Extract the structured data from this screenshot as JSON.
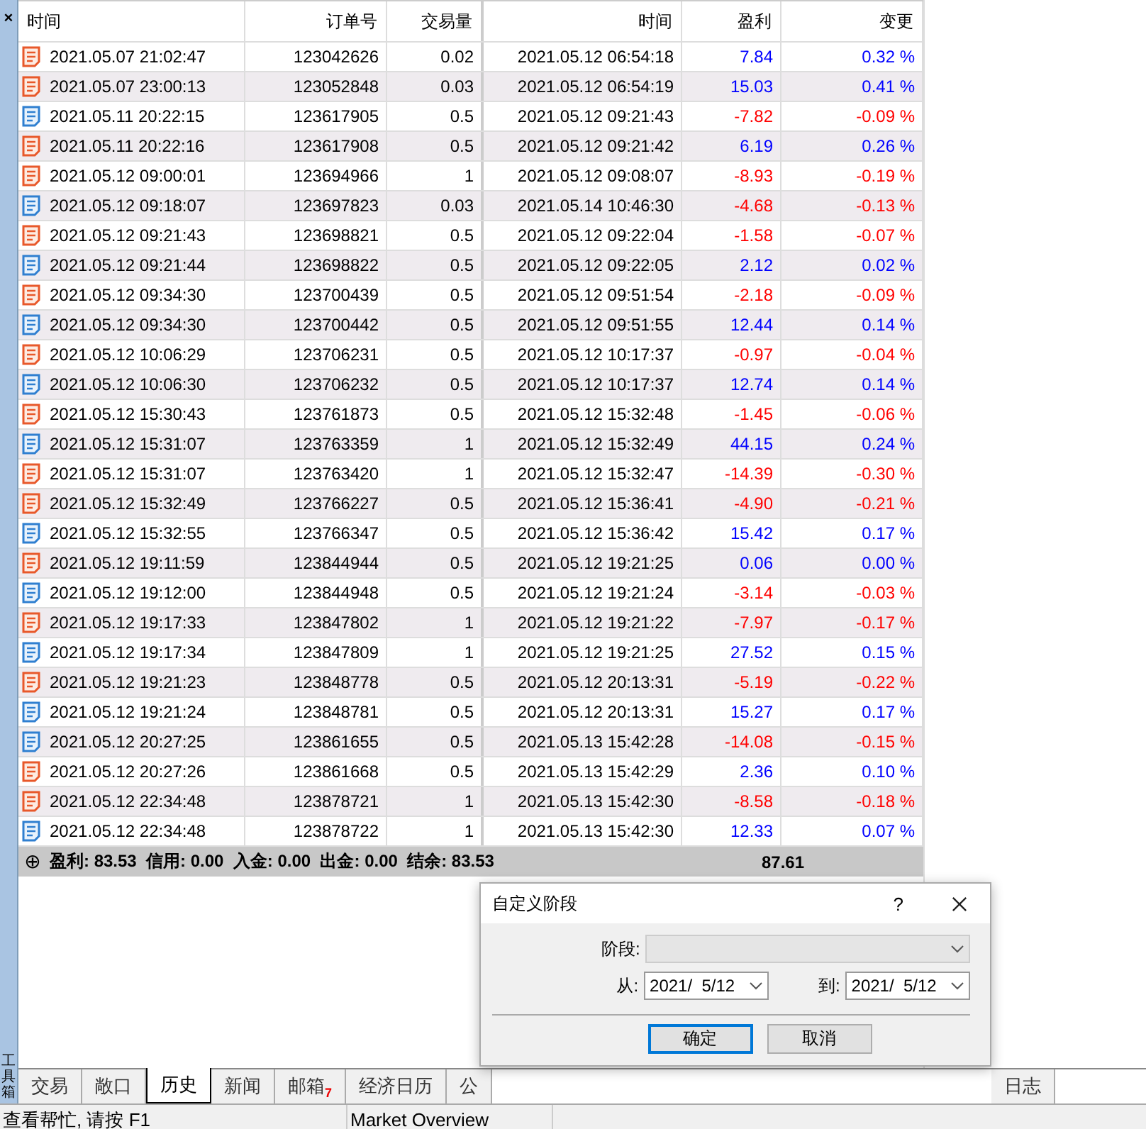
{
  "toolbox": {
    "close": "×",
    "title": "工具箱"
  },
  "table": {
    "columns": [
      "时间",
      "订单号",
      "交易量",
      "时间",
      "盈利",
      "变更"
    ],
    "rows": [
      {
        "kind": "sell",
        "open_time": "2021.05.07 21:02:47",
        "order": "123042626",
        "volume": "0.02",
        "close_time": "2021.05.12 06:54:18",
        "profit": "7.84",
        "change": "0.32 %",
        "loss": false
      },
      {
        "kind": "sell",
        "open_time": "2021.05.07 23:00:13",
        "order": "123052848",
        "volume": "0.03",
        "close_time": "2021.05.12 06:54:19",
        "profit": "15.03",
        "change": "0.41 %",
        "loss": false
      },
      {
        "kind": "buy",
        "open_time": "2021.05.11 20:22:15",
        "order": "123617905",
        "volume": "0.5",
        "close_time": "2021.05.12 09:21:43",
        "profit": "-7.82",
        "change": "-0.09 %",
        "loss": true
      },
      {
        "kind": "sell",
        "open_time": "2021.05.11 20:22:16",
        "order": "123617908",
        "volume": "0.5",
        "close_time": "2021.05.12 09:21:42",
        "profit": "6.19",
        "change": "0.26 %",
        "loss": false
      },
      {
        "kind": "sell",
        "open_time": "2021.05.12 09:00:01",
        "order": "123694966",
        "volume": "1",
        "close_time": "2021.05.12 09:08:07",
        "profit": "-8.93",
        "change": "-0.19 %",
        "loss": true
      },
      {
        "kind": "buy",
        "open_time": "2021.05.12 09:18:07",
        "order": "123697823",
        "volume": "0.03",
        "close_time": "2021.05.14 10:46:30",
        "profit": "-4.68",
        "change": "-0.13 %",
        "loss": true
      },
      {
        "kind": "sell",
        "open_time": "2021.05.12 09:21:43",
        "order": "123698821",
        "volume": "0.5",
        "close_time": "2021.05.12 09:22:04",
        "profit": "-1.58",
        "change": "-0.07 %",
        "loss": true
      },
      {
        "kind": "buy",
        "open_time": "2021.05.12 09:21:44",
        "order": "123698822",
        "volume": "0.5",
        "close_time": "2021.05.12 09:22:05",
        "profit": "2.12",
        "change": "0.02 %",
        "loss": false
      },
      {
        "kind": "sell",
        "open_time": "2021.05.12 09:34:30",
        "order": "123700439",
        "volume": "0.5",
        "close_time": "2021.05.12 09:51:54",
        "profit": "-2.18",
        "change": "-0.09 %",
        "loss": true
      },
      {
        "kind": "buy",
        "open_time": "2021.05.12 09:34:30",
        "order": "123700442",
        "volume": "0.5",
        "close_time": "2021.05.12 09:51:55",
        "profit": "12.44",
        "change": "0.14 %",
        "loss": false
      },
      {
        "kind": "sell",
        "open_time": "2021.05.12 10:06:29",
        "order": "123706231",
        "volume": "0.5",
        "close_time": "2021.05.12 10:17:37",
        "profit": "-0.97",
        "change": "-0.04 %",
        "loss": true
      },
      {
        "kind": "buy",
        "open_time": "2021.05.12 10:06:30",
        "order": "123706232",
        "volume": "0.5",
        "close_time": "2021.05.12 10:17:37",
        "profit": "12.74",
        "change": "0.14 %",
        "loss": false
      },
      {
        "kind": "sell",
        "open_time": "2021.05.12 15:30:43",
        "order": "123761873",
        "volume": "0.5",
        "close_time": "2021.05.12 15:32:48",
        "profit": "-1.45",
        "change": "-0.06 %",
        "loss": true
      },
      {
        "kind": "buy",
        "open_time": "2021.05.12 15:31:07",
        "order": "123763359",
        "volume": "1",
        "close_time": "2021.05.12 15:32:49",
        "profit": "44.15",
        "change": "0.24 %",
        "loss": false
      },
      {
        "kind": "sell",
        "open_time": "2021.05.12 15:31:07",
        "order": "123763420",
        "volume": "1",
        "close_time": "2021.05.12 15:32:47",
        "profit": "-14.39",
        "change": "-0.30 %",
        "loss": true
      },
      {
        "kind": "sell",
        "open_time": "2021.05.12 15:32:49",
        "order": "123766227",
        "volume": "0.5",
        "close_time": "2021.05.12 15:36:41",
        "profit": "-4.90",
        "change": "-0.21 %",
        "loss": true
      },
      {
        "kind": "buy",
        "open_time": "2021.05.12 15:32:55",
        "order": "123766347",
        "volume": "0.5",
        "close_time": "2021.05.12 15:36:42",
        "profit": "15.42",
        "change": "0.17 %",
        "loss": false
      },
      {
        "kind": "sell",
        "open_time": "2021.05.12 19:11:59",
        "order": "123844944",
        "volume": "0.5",
        "close_time": "2021.05.12 19:21:25",
        "profit": "0.06",
        "change": "0.00 %",
        "loss": false
      },
      {
        "kind": "buy",
        "open_time": "2021.05.12 19:12:00",
        "order": "123844948",
        "volume": "0.5",
        "close_time": "2021.05.12 19:21:24",
        "profit": "-3.14",
        "change": "-0.03 %",
        "loss": true
      },
      {
        "kind": "sell",
        "open_time": "2021.05.12 19:17:33",
        "order": "123847802",
        "volume": "1",
        "close_time": "2021.05.12 19:21:22",
        "profit": "-7.97",
        "change": "-0.17 %",
        "loss": true
      },
      {
        "kind": "buy",
        "open_time": "2021.05.12 19:17:34",
        "order": "123847809",
        "volume": "1",
        "close_time": "2021.05.12 19:21:25",
        "profit": "27.52",
        "change": "0.15 %",
        "loss": false
      },
      {
        "kind": "sell",
        "open_time": "2021.05.12 19:21:23",
        "order": "123848778",
        "volume": "0.5",
        "close_time": "2021.05.12 20:13:31",
        "profit": "-5.19",
        "change": "-0.22 %",
        "loss": true
      },
      {
        "kind": "buy",
        "open_time": "2021.05.12 19:21:24",
        "order": "123848781",
        "volume": "0.5",
        "close_time": "2021.05.12 20:13:31",
        "profit": "15.27",
        "change": "0.17 %",
        "loss": false
      },
      {
        "kind": "buy",
        "open_time": "2021.05.12 20:27:25",
        "order": "123861655",
        "volume": "0.5",
        "close_time": "2021.05.13 15:42:28",
        "profit": "-14.08",
        "change": "-0.15 %",
        "loss": true
      },
      {
        "kind": "sell",
        "open_time": "2021.05.12 20:27:26",
        "order": "123861668",
        "volume": "0.5",
        "close_time": "2021.05.13 15:42:29",
        "profit": "2.36",
        "change": "0.10 %",
        "loss": false
      },
      {
        "kind": "sell",
        "open_time": "2021.05.12 22:34:48",
        "order": "123878721",
        "volume": "1",
        "close_time": "2021.05.13 15:42:30",
        "profit": "-8.58",
        "change": "-0.18 %",
        "loss": true
      },
      {
        "kind": "buy",
        "open_time": "2021.05.12 22:34:48",
        "order": "123878722",
        "volume": "1",
        "close_time": "2021.05.13 15:42:30",
        "profit": "12.33",
        "change": "0.07 %",
        "loss": false
      }
    ],
    "summary": {
      "expand": "⊕",
      "text": "盈利: 83.53  信用: 0.00  入金: 0.00  出金: 0.00  结余: 83.53",
      "profit": "87.61"
    }
  },
  "tabs": [
    {
      "label": "交易",
      "selected": false
    },
    {
      "label": "敞口",
      "selected": false
    },
    {
      "label": "历史",
      "selected": true
    },
    {
      "label": "新闻",
      "selected": false
    },
    {
      "label": "邮箱",
      "badge": "7",
      "selected": false
    },
    {
      "label": "经济日历",
      "selected": false
    },
    {
      "label": "公",
      "selected": false
    },
    {
      "label": "日志",
      "selected": false
    }
  ],
  "status_bar": [
    "查看帮忙, 请按 F1",
    "Market Overview"
  ],
  "dialog": {
    "title": "自定义阶段",
    "help": "?",
    "period_label": "阶段:",
    "from_label": "从:",
    "from": "2021/  5/12",
    "to_label": "到:",
    "to": "2021/  5/12",
    "ok": "确定",
    "cancel": "取消"
  }
}
